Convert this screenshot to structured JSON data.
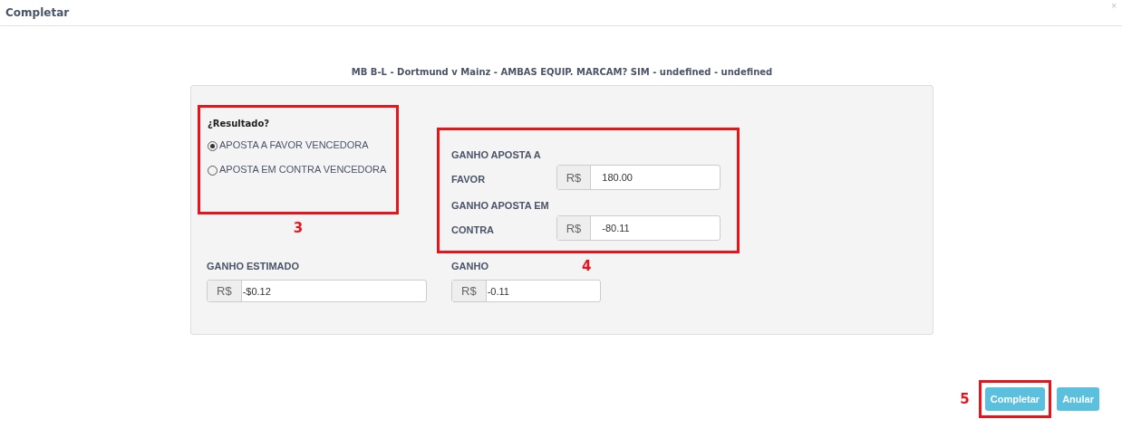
{
  "dialog": {
    "title": "Completar",
    "close": "×"
  },
  "match_title": "MB B-L - Dortmund v Mainz - AMBAS EQUIP. MARCAM? SIM - undefined - undefined",
  "result": {
    "question": "¿Resultado?",
    "annotation": "3",
    "options": [
      {
        "label": "APOSTA A FAVOR VENCEDORA",
        "selected": true
      },
      {
        "label": "APOSTA EM CONTRA VENCEDORA",
        "selected": false
      }
    ]
  },
  "bets": {
    "annotation": "4",
    "fields": [
      {
        "label": "GANHO APOSTA A FAVOR",
        "prefix": "R$",
        "value": "180.00"
      },
      {
        "label": "GANHO APOSTA EM CONTRA",
        "prefix": "R$",
        "value": "-80.11"
      }
    ]
  },
  "totals": [
    {
      "label": "GANHO ESTIMADO",
      "prefix": "R$",
      "value": "-$0.12"
    },
    {
      "label": "GANHO",
      "prefix": "R$",
      "value": "-0.11"
    }
  ],
  "buttons": {
    "annotation": "5",
    "items": [
      {
        "label": "Completar",
        "highlighted": true
      },
      {
        "label": "Anular",
        "highlighted": false
      }
    ]
  }
}
